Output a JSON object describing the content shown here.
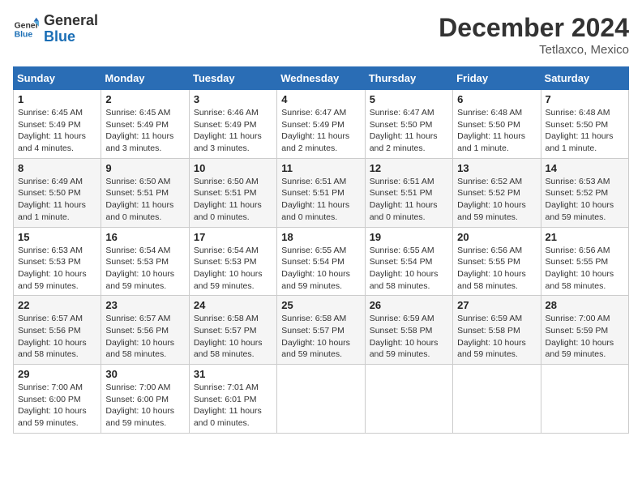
{
  "header": {
    "logo_general": "General",
    "logo_blue": "Blue",
    "month_year": "December 2024",
    "location": "Tetlaxco, Mexico"
  },
  "weekdays": [
    "Sunday",
    "Monday",
    "Tuesday",
    "Wednesday",
    "Thursday",
    "Friday",
    "Saturday"
  ],
  "weeks": [
    [
      {
        "day": "1",
        "sunrise": "6:45 AM",
        "sunset": "5:49 PM",
        "daylight": "11 hours and 4 minutes."
      },
      {
        "day": "2",
        "sunrise": "6:45 AM",
        "sunset": "5:49 PM",
        "daylight": "11 hours and 3 minutes."
      },
      {
        "day": "3",
        "sunrise": "6:46 AM",
        "sunset": "5:49 PM",
        "daylight": "11 hours and 3 minutes."
      },
      {
        "day": "4",
        "sunrise": "6:47 AM",
        "sunset": "5:49 PM",
        "daylight": "11 hours and 2 minutes."
      },
      {
        "day": "5",
        "sunrise": "6:47 AM",
        "sunset": "5:50 PM",
        "daylight": "11 hours and 2 minutes."
      },
      {
        "day": "6",
        "sunrise": "6:48 AM",
        "sunset": "5:50 PM",
        "daylight": "11 hours and 1 minute."
      },
      {
        "day": "7",
        "sunrise": "6:48 AM",
        "sunset": "5:50 PM",
        "daylight": "11 hours and 1 minute."
      }
    ],
    [
      {
        "day": "8",
        "sunrise": "6:49 AM",
        "sunset": "5:50 PM",
        "daylight": "11 hours and 1 minute."
      },
      {
        "day": "9",
        "sunrise": "6:50 AM",
        "sunset": "5:51 PM",
        "daylight": "11 hours and 0 minutes."
      },
      {
        "day": "10",
        "sunrise": "6:50 AM",
        "sunset": "5:51 PM",
        "daylight": "11 hours and 0 minutes."
      },
      {
        "day": "11",
        "sunrise": "6:51 AM",
        "sunset": "5:51 PM",
        "daylight": "11 hours and 0 minutes."
      },
      {
        "day": "12",
        "sunrise": "6:51 AM",
        "sunset": "5:51 PM",
        "daylight": "11 hours and 0 minutes."
      },
      {
        "day": "13",
        "sunrise": "6:52 AM",
        "sunset": "5:52 PM",
        "daylight": "10 hours and 59 minutes."
      },
      {
        "day": "14",
        "sunrise": "6:53 AM",
        "sunset": "5:52 PM",
        "daylight": "10 hours and 59 minutes."
      }
    ],
    [
      {
        "day": "15",
        "sunrise": "6:53 AM",
        "sunset": "5:53 PM",
        "daylight": "10 hours and 59 minutes."
      },
      {
        "day": "16",
        "sunrise": "6:54 AM",
        "sunset": "5:53 PM",
        "daylight": "10 hours and 59 minutes."
      },
      {
        "day": "17",
        "sunrise": "6:54 AM",
        "sunset": "5:53 PM",
        "daylight": "10 hours and 59 minutes."
      },
      {
        "day": "18",
        "sunrise": "6:55 AM",
        "sunset": "5:54 PM",
        "daylight": "10 hours and 59 minutes."
      },
      {
        "day": "19",
        "sunrise": "6:55 AM",
        "sunset": "5:54 PM",
        "daylight": "10 hours and 58 minutes."
      },
      {
        "day": "20",
        "sunrise": "6:56 AM",
        "sunset": "5:55 PM",
        "daylight": "10 hours and 58 minutes."
      },
      {
        "day": "21",
        "sunrise": "6:56 AM",
        "sunset": "5:55 PM",
        "daylight": "10 hours and 58 minutes."
      }
    ],
    [
      {
        "day": "22",
        "sunrise": "6:57 AM",
        "sunset": "5:56 PM",
        "daylight": "10 hours and 58 minutes."
      },
      {
        "day": "23",
        "sunrise": "6:57 AM",
        "sunset": "5:56 PM",
        "daylight": "10 hours and 58 minutes."
      },
      {
        "day": "24",
        "sunrise": "6:58 AM",
        "sunset": "5:57 PM",
        "daylight": "10 hours and 58 minutes."
      },
      {
        "day": "25",
        "sunrise": "6:58 AM",
        "sunset": "5:57 PM",
        "daylight": "10 hours and 59 minutes."
      },
      {
        "day": "26",
        "sunrise": "6:59 AM",
        "sunset": "5:58 PM",
        "daylight": "10 hours and 59 minutes."
      },
      {
        "day": "27",
        "sunrise": "6:59 AM",
        "sunset": "5:58 PM",
        "daylight": "10 hours and 59 minutes."
      },
      {
        "day": "28",
        "sunrise": "7:00 AM",
        "sunset": "5:59 PM",
        "daylight": "10 hours and 59 minutes."
      }
    ],
    [
      {
        "day": "29",
        "sunrise": "7:00 AM",
        "sunset": "6:00 PM",
        "daylight": "10 hours and 59 minutes."
      },
      {
        "day": "30",
        "sunrise": "7:00 AM",
        "sunset": "6:00 PM",
        "daylight": "10 hours and 59 minutes."
      },
      {
        "day": "31",
        "sunrise": "7:01 AM",
        "sunset": "6:01 PM",
        "daylight": "11 hours and 0 minutes."
      },
      null,
      null,
      null,
      null
    ]
  ]
}
